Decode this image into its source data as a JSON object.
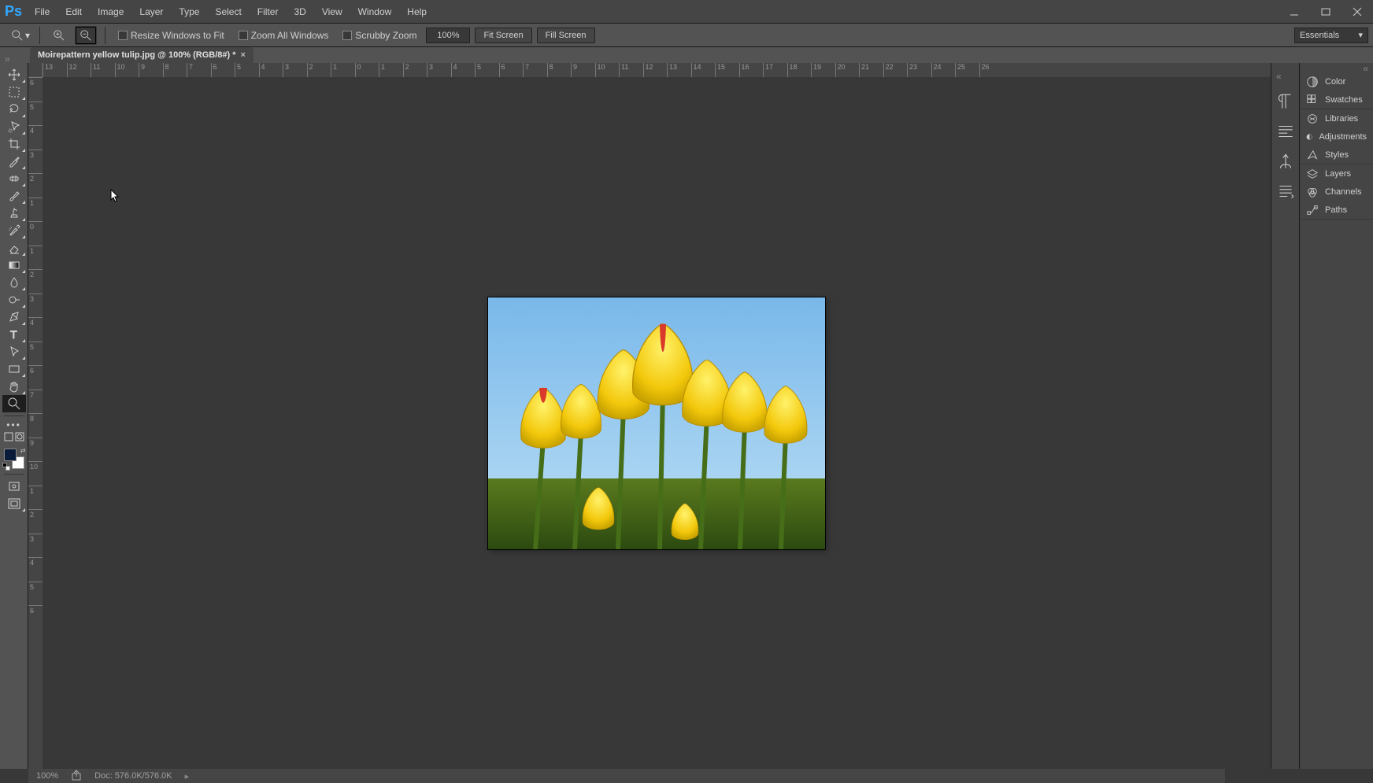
{
  "app_name": "Ps",
  "menu": [
    "File",
    "Edit",
    "Image",
    "Layer",
    "Type",
    "Select",
    "Filter",
    "3D",
    "View",
    "Window",
    "Help"
  ],
  "options_bar": {
    "resize_fit": "Resize Windows to Fit",
    "zoom_all": "Zoom All Windows",
    "scrubby": "Scrubby Zoom",
    "zoom_pct": "100%",
    "fit_screen": "Fit Screen",
    "fill_screen": "Fill Screen"
  },
  "workspace": "Essentials",
  "document_tab": "Moirepattern yellow tulip.jpg @ 100% (RGB/8#) *",
  "ruler_h": [
    "13",
    "12",
    "11",
    "10",
    "9",
    "8",
    "7",
    "6",
    "5",
    "4",
    "3",
    "2",
    "1",
    "0",
    "1",
    "2",
    "3",
    "4",
    "5",
    "6",
    "7",
    "8",
    "9",
    "10",
    "11",
    "12",
    "13",
    "14",
    "15",
    "16",
    "17",
    "18",
    "19",
    "20",
    "21",
    "22",
    "23",
    "24",
    "25",
    "26"
  ],
  "ruler_v": [
    "6",
    "5",
    "4",
    "3",
    "2",
    "1",
    "0",
    "1",
    "2",
    "3",
    "4",
    "5",
    "6",
    "7",
    "8",
    "9",
    "10",
    "1",
    "2",
    "3",
    "4",
    "5",
    "6"
  ],
  "toolbar_tools": [
    "move-tool",
    "marquee-tool",
    "lasso-tool",
    "quick-select-tool",
    "crop-tool",
    "eyedropper-tool",
    "healing-brush-tool",
    "brush-tool",
    "clone-stamp-tool",
    "history-brush-tool",
    "eraser-tool",
    "gradient-tool",
    "blur-tool",
    "dodge-tool",
    "pen-tool",
    "type-tool",
    "path-select-tool",
    "rectangle-tool",
    "hand-tool",
    "zoom-tool"
  ],
  "right_panels": {
    "g1": [
      "Color",
      "Swatches"
    ],
    "g2": [
      "Libraries",
      "Adjustments",
      "Styles"
    ],
    "g3": [
      "Layers",
      "Channels",
      "Paths"
    ]
  },
  "status": {
    "zoom": "100%",
    "doc": "Doc: 576.0K/576.0K"
  }
}
